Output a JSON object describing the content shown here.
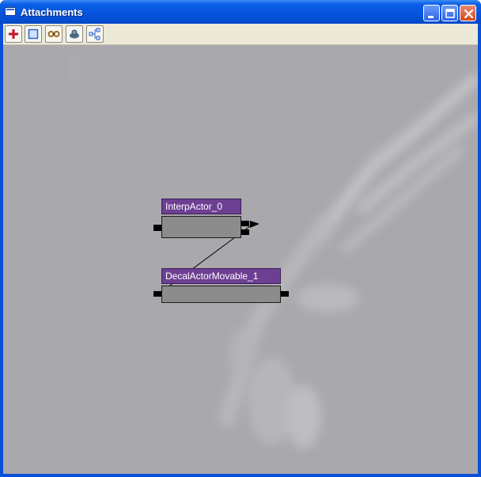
{
  "window": {
    "title": "Attachments"
  },
  "titlebar_buttons": {
    "minimize": "minimize-icon",
    "maximize": "maximize-icon",
    "close": "close-icon"
  },
  "toolbar": {
    "tools": [
      {
        "icon": "add-icon",
        "color": "#c8102e"
      },
      {
        "icon": "box-select-icon",
        "color": "#2f62c9"
      },
      {
        "icon": "link-icon",
        "color": "#9a6b1f"
      },
      {
        "icon": "actor-icon",
        "color": "#4d6b86"
      },
      {
        "icon": "tree-layout-icon",
        "color": "#2f62c9"
      }
    ]
  },
  "graph": {
    "nodes": [
      {
        "label": "InterpActor_0"
      },
      {
        "label": "DecalActorMovable_1"
      }
    ],
    "colors": {
      "node_header": "#6d3f92",
      "node_body": "#8c8c8c",
      "canvas": "#a9a8ad"
    }
  }
}
